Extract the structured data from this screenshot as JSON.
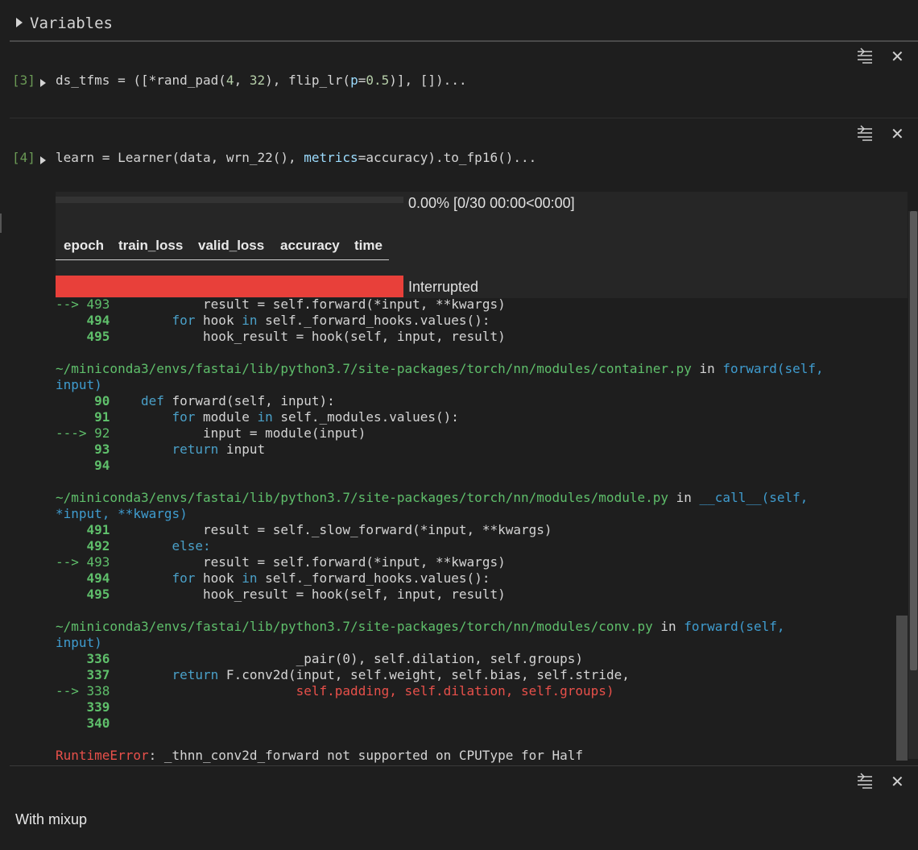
{
  "variables": {
    "label": "Variables"
  },
  "cells": {
    "c3": {
      "prompt": "[3]",
      "code_a": "ds_tfms = ([*rand_pad(",
      "n4": "4",
      "sep": ", ",
      "n32": "32",
      "code_b": "), flip_lr(",
      "p": "p",
      "eq": "=",
      "n05": "0.5",
      "code_c": ")], [])..."
    },
    "c4": {
      "prompt": "[4]",
      "code_a": "learn = Learner(data, wrn_22(), ",
      "metrics": "metrics",
      "code_b": "=accuracy).to_fp16()..."
    }
  },
  "progress": {
    "text": "0.00% [0/30 00:00<00:00]",
    "fraction": 0.0
  },
  "table": {
    "headers": [
      "epoch",
      "train_loss",
      "valid_loss",
      "accuracy",
      "time"
    ]
  },
  "status": {
    "interrupted": "Interrupted"
  },
  "traceback": {
    "l1": {
      "arrow": "--> 493",
      "code": "            result = self.forward(*input, **kwargs)"
    },
    "l2": {
      "num": "    494",
      "kw": "        for",
      "code": " hook ",
      "in": "in",
      "rest": " self._forward_hooks.values():"
    },
    "l3": {
      "num": "    495",
      "code": "            hook_result = hook(self, input, result)"
    },
    "f1_path": "~/miniconda3/envs/fastai/lib/python3.7/site-packages/torch/nn/modules/container.py",
    "f1_in": " in ",
    "f1_fn": "forward(self,",
    "f1_fn2": "input)",
    "m1": {
      "num": "     90",
      "kw": "    def",
      "code": " forward(self, input):"
    },
    "m2": {
      "num": "     91",
      "kw": "        for",
      "code": " module ",
      "in": "in",
      "rest": " self._modules.values():"
    },
    "m3": {
      "arrow": "---> 92",
      "code": "            input = module(input)"
    },
    "m4": {
      "num": "     93",
      "kw": "        return",
      "code": " input"
    },
    "m5": {
      "num": "     94"
    },
    "f2_path": "~/miniconda3/envs/fastai/lib/python3.7/site-packages/torch/nn/modules/module.py",
    "f2_in": " in ",
    "f2_fn": "__call__(self,",
    "f2_fn2": "*input, **kwargs)",
    "n1": {
      "num": "    491",
      "code": "            result = self._slow_forward(*input, **kwargs)"
    },
    "n2": {
      "num": "    492",
      "kw": "        else:"
    },
    "n3": {
      "arrow": "--> 493",
      "code": "            result = self.forward(*input, **kwargs)"
    },
    "n4": {
      "num": "    494",
      "kw": "        for",
      "code": " hook ",
      "in": "in",
      "rest": " self._forward_hooks.values():"
    },
    "n5": {
      "num": "    495",
      "code": "            hook_result = hook(self, input, result)"
    },
    "f3_path": "~/miniconda3/envs/fastai/lib/python3.7/site-packages/torch/nn/modules/conv.py",
    "f3_in": " in ",
    "f3_fn": "forward(self,",
    "f3_fn2": "input)",
    "o1": {
      "num": "    336",
      "code": "                        _pair(0), self.dilation, self.groups)"
    },
    "o2": {
      "num": "    337",
      "kw": "        return",
      "code": " F.conv2d(input, self.weight, self.bias, self.stride,"
    },
    "o3": {
      "arrow": "--> 338",
      "code": "                        ",
      "err": "self.padding, self.dilation, self.groups)"
    },
    "o4": {
      "num": "    339"
    },
    "o5": {
      "num": "    340"
    },
    "error_type": "RuntimeError",
    "error_msg": ": _thnn_conv2d_forward not supported on CPUType for Half"
  },
  "markdown": {
    "text": "With mixup"
  },
  "colors": {
    "background": "#1e1e1e",
    "error": "#e8403a",
    "prompt": "#6a9955",
    "line_number": "#5fbf6b"
  }
}
